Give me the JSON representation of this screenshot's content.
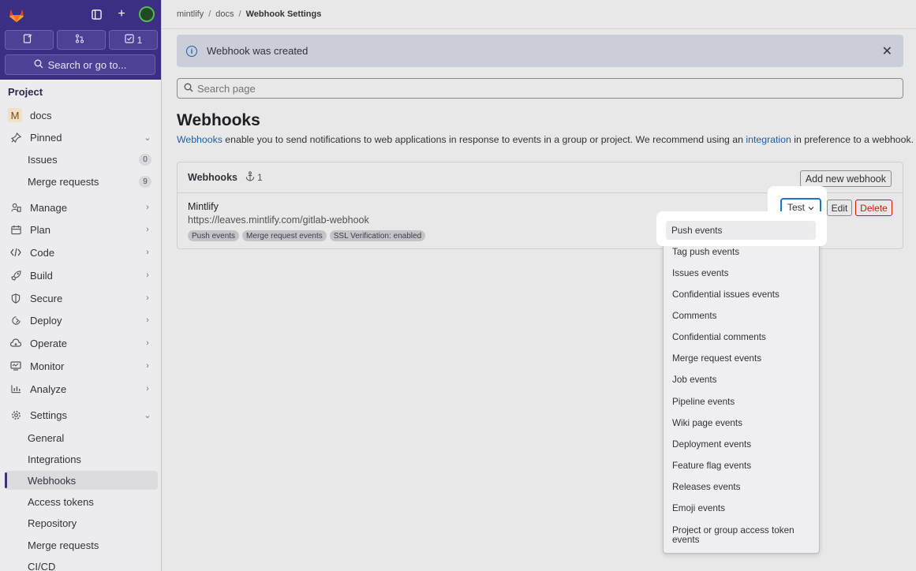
{
  "sidebar": {
    "top_buttons": {
      "issues_count": "",
      "mr_count": "",
      "todo_count": "1"
    },
    "search_label": "Search or go to...",
    "section_title": "Project",
    "project": {
      "avatar_letter": "M",
      "name": "docs"
    },
    "pinned": {
      "label": "Pinned",
      "items": [
        {
          "label": "Issues",
          "count": "0"
        },
        {
          "label": "Merge requests",
          "count": "9"
        }
      ]
    },
    "groups": [
      "Manage",
      "Plan",
      "Code",
      "Build",
      "Secure",
      "Deploy",
      "Operate",
      "Monitor",
      "Analyze"
    ],
    "settings": {
      "label": "Settings",
      "items": [
        "General",
        "Integrations",
        "Webhooks",
        "Access tokens",
        "Repository",
        "Merge requests",
        "CI/CD"
      ]
    }
  },
  "breadcrumb": {
    "items": [
      "mintlify",
      "docs",
      "Webhook Settings"
    ]
  },
  "alert": {
    "text": "Webhook was created"
  },
  "page_search": {
    "placeholder": "Search page"
  },
  "page": {
    "title": "Webhooks",
    "description": {
      "link1": "Webhooks",
      "text1": " enable you to send notifications to web applications in response to events in a group or project. We recommend using an ",
      "link2": "integration",
      "text2": " in preference to a webhook."
    }
  },
  "card": {
    "title": "Webhooks",
    "count": "1",
    "add_label": "Add new webhook",
    "hook": {
      "name": "Mintlify",
      "url": "https://leaves.mintlify.com/gitlab-webhook",
      "badges": [
        "Push events",
        "Merge request events",
        "SSL Verification: enabled"
      ],
      "test_label": "Test",
      "edit_label": "Edit",
      "delete_label": "Delete"
    }
  },
  "dropdown": {
    "items": [
      "Push events",
      "Tag push events",
      "Issues events",
      "Confidential issues events",
      "Comments",
      "Confidential comments",
      "Merge request events",
      "Job events",
      "Pipeline events",
      "Wiki page events",
      "Deployment events",
      "Feature flag events",
      "Releases events",
      "Emoji events",
      "Project or group access token events"
    ]
  },
  "colors": {
    "sidebar_top": "#3a2f83",
    "link": "#1f5fa8",
    "danger": "#c91c00",
    "focus": "#1f75cb"
  }
}
